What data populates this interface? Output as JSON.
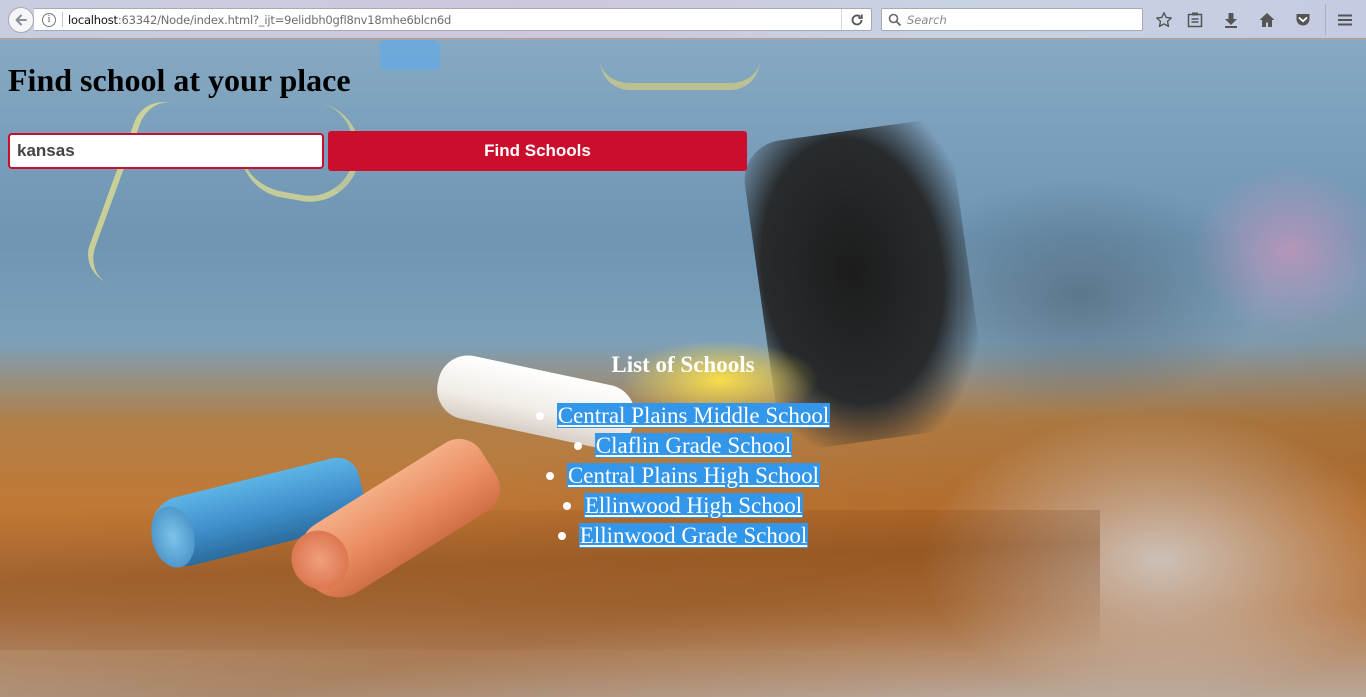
{
  "browser": {
    "url_host": "localhost",
    "url_rest": ":63342/Node/index.html?_ijt=9elidbh0gfl8nv18mhe6blcn6d",
    "search_placeholder": "Search",
    "icons": [
      "back-arrow-icon",
      "info-icon",
      "reload-icon",
      "search-icon",
      "bookmark-star-icon",
      "reading-list-icon",
      "download-icon",
      "home-icon",
      "pocket-icon",
      "menu-icon"
    ]
  },
  "page": {
    "heading": "Find school at your place",
    "search": {
      "value": "kansas"
    },
    "find_button_label": "Find Schools",
    "list_title": "List of Schools",
    "schools": [
      "Central Plains Middle School",
      "Claflin Grade School",
      "Central Plains High School",
      "Ellinwood High School",
      "Ellinwood Grade School"
    ],
    "colors": {
      "accent_red": "#cc0e2d",
      "link_highlight": "#3296ea"
    }
  }
}
